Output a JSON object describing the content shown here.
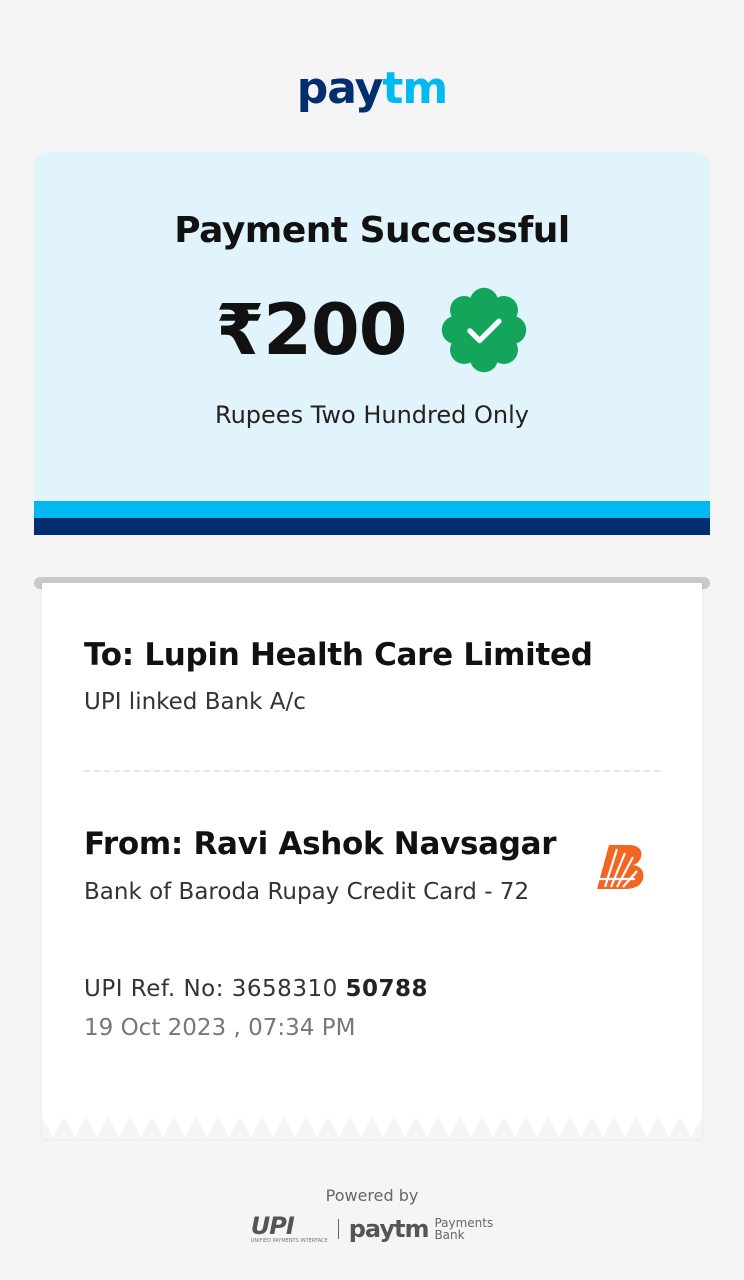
{
  "header": {
    "logo_pay": "pay",
    "logo_tm": "tm"
  },
  "status": {
    "title": "Payment Successful",
    "amount": "₹200",
    "amount_words": "Rupees Two Hundred Only",
    "badge_icon": "verified-check-badge-icon",
    "badge_color": "#13a65a"
  },
  "payee": {
    "name": "To: Lupin Health Care Limited",
    "account": "UPI linked Bank A/c"
  },
  "payer": {
    "name": "From: Ravi Ashok Navsagar",
    "account": "Bank of Baroda Rupay Credit Card - 72",
    "bank_logo": "bank-of-baroda-logo-icon"
  },
  "transaction": {
    "ref_label": "UPI Ref. No:",
    "ref_prefix": "3658310",
    "ref_suffix": "50788",
    "datetime": "19 Oct 2023 , 07:34 PM"
  },
  "footer": {
    "powered_by": "Powered by",
    "upi_text": "UPI",
    "upi_subtext": "UNIFIED PAYMENTS INTERFACE",
    "paytm_text": "paytm",
    "bank_line1": "Payments",
    "bank_line2": "Bank"
  },
  "colors": {
    "background": "#f5f5f5",
    "card_background": "#e1f4fb",
    "paytm_navy": "#002e6e",
    "paytm_cyan": "#00b9f1",
    "bob_orange": "#f26522"
  }
}
